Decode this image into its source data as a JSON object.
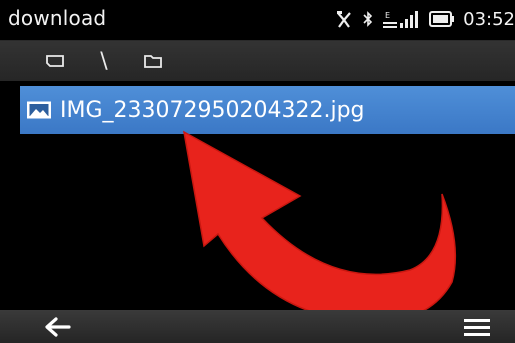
{
  "status_bar": {
    "title": "download",
    "clock": "03:52",
    "icons": [
      "silent-mode-icon",
      "bluetooth-icon",
      "network-signal-icon",
      "battery-icon"
    ]
  },
  "path_bar": {
    "items": [
      "memory-card-icon",
      "\\",
      "folder-icon"
    ]
  },
  "file_list": {
    "items": [
      {
        "name": "IMG_233072950204322.jpg",
        "icon": "image-file-icon",
        "selected": true
      }
    ]
  },
  "overlay": {
    "arrow_color": "#e8231c"
  },
  "toolbar": {
    "back_icon": "back-arrow-icon",
    "menu_icon": "menu-icon"
  },
  "colors": {
    "background": "#000000",
    "selection": "#4285d0",
    "text": "#ffffff"
  }
}
